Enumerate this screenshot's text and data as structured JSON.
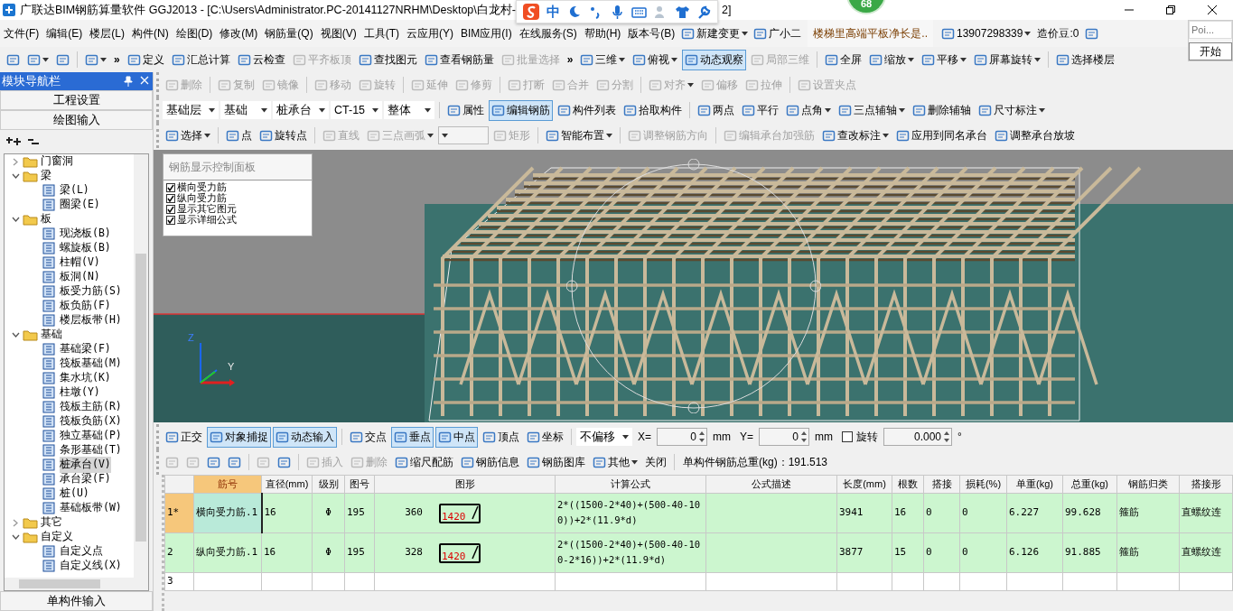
{
  "window": {
    "title": "广联达BIM钢筋算量软件 GGJ2013 - [C:\\Users\\Administrator.PC-20141127NRHM\\Desktop\\白龙村-",
    "title_tail": "2]",
    "badge": "68"
  },
  "ime_bar": {
    "mode": "中"
  },
  "menu_bar": {
    "menus": [
      "文件(F)",
      "编辑(E)",
      "楼层(L)",
      "构件(N)",
      "绘图(D)",
      "修改(M)",
      "钢筋量(Q)",
      "视图(V)",
      "工具(T)",
      "云应用(Y)",
      "BIM应用(I)",
      "在线服务(S)",
      "帮助(H)",
      "版本号(B)"
    ],
    "extras": [
      {
        "kind": "tool",
        "label": "新建变更",
        "disabled": false,
        "pressed": false,
        "dropdown": true
      },
      {
        "kind": "tool",
        "label": "广小二",
        "disabled": false,
        "pressed": false,
        "dropdown": false
      },
      {
        "kind": "news",
        "label": "楼梯里高端平板净长是.."
      },
      {
        "kind": "tool",
        "label": "13907298339",
        "disabled": false,
        "pressed": false,
        "dropdown": true
      },
      {
        "kind": "label",
        "label": "造价豆:0"
      },
      {
        "kind": "icon_tool",
        "disabled": false,
        "pressed": false,
        "dropdown": false
      }
    ]
  },
  "popup": {
    "placeholder": "Poi...",
    "button": "开始"
  },
  "main_toolbar": [
    {
      "kind": "icon_tool",
      "disabled": false,
      "pressed": false,
      "dropdown": false
    },
    {
      "kind": "icon_tool",
      "disabled": false,
      "pressed": false,
      "dropdown": true
    },
    {
      "kind": "icon_tool",
      "disabled": false,
      "pressed": false,
      "dropdown": false
    },
    {
      "kind": "sep"
    },
    {
      "kind": "icon_tool",
      "disabled": false,
      "pressed": false,
      "dropdown": true
    },
    {
      "kind": "overflow",
      "label": "»"
    },
    {
      "kind": "tool",
      "label": "定义",
      "disabled": false,
      "pressed": false,
      "dropdown": false
    },
    {
      "kind": "tool",
      "label": "汇总计算",
      "disabled": false,
      "pressed": false,
      "dropdown": false
    },
    {
      "kind": "tool",
      "label": "云检查",
      "disabled": false,
      "pressed": false,
      "dropdown": false
    },
    {
      "kind": "tool",
      "label": "平齐板顶",
      "disabled": true,
      "pressed": false,
      "dropdown": false
    },
    {
      "kind": "tool",
      "label": "查找图元",
      "disabled": false,
      "pressed": false,
      "dropdown": false
    },
    {
      "kind": "tool",
      "label": "查看钢筋量",
      "disabled": false,
      "pressed": false,
      "dropdown": false
    },
    {
      "kind": "tool",
      "label": "批量选择",
      "disabled": true,
      "pressed": false,
      "dropdown": false
    },
    {
      "kind": "overflow",
      "label": "»"
    },
    {
      "kind": "tool",
      "label": "三维",
      "disabled": false,
      "pressed": false,
      "dropdown": true
    },
    {
      "kind": "tool",
      "label": "俯视",
      "disabled": false,
      "pressed": false,
      "dropdown": true
    },
    {
      "kind": "tool",
      "label": "动态观察",
      "disabled": false,
      "pressed": true,
      "dropdown": false
    },
    {
      "kind": "tool",
      "label": "局部三维",
      "disabled": true,
      "pressed": false,
      "dropdown": false
    },
    {
      "kind": "sep"
    },
    {
      "kind": "tool",
      "label": "全屏",
      "disabled": false,
      "pressed": false,
      "dropdown": false
    },
    {
      "kind": "tool",
      "label": "缩放",
      "disabled": false,
      "pressed": false,
      "dropdown": true
    },
    {
      "kind": "tool",
      "label": "平移",
      "disabled": false,
      "pressed": false,
      "dropdown": true
    },
    {
      "kind": "tool",
      "label": "屏幕旋转",
      "disabled": false,
      "pressed": false,
      "dropdown": true
    },
    {
      "kind": "sep"
    },
    {
      "kind": "tool",
      "label": "选择楼层",
      "disabled": false,
      "pressed": false,
      "dropdown": false
    }
  ],
  "sidebar": {
    "title": "模块导航栏",
    "buttons": [
      "工程设置",
      "绘图输入"
    ],
    "bottom_button": "单构件输入",
    "tree": [
      {
        "label": "门窗洞",
        "expanded": false,
        "selected": false
      },
      {
        "label": "梁",
        "expanded": true,
        "selected": false,
        "children": [
          {
            "label": "梁(L)",
            "selected": false
          },
          {
            "label": "圈梁(E)",
            "selected": false
          }
        ]
      },
      {
        "label": "板",
        "expanded": true,
        "selected": false,
        "children": [
          {
            "label": "现浇板(B)",
            "selected": false
          },
          {
            "label": "螺旋板(B)",
            "selected": false
          },
          {
            "label": "柱帽(V)",
            "selected": false
          },
          {
            "label": "板洞(N)",
            "selected": false
          },
          {
            "label": "板受力筋(S)",
            "selected": false
          },
          {
            "label": "板负筋(F)",
            "selected": false
          },
          {
            "label": "楼层板带(H)",
            "selected": false
          }
        ]
      },
      {
        "label": "基础",
        "expanded": true,
        "selected": false,
        "children": [
          {
            "label": "基础梁(F)",
            "selected": false
          },
          {
            "label": "筏板基础(M)",
            "selected": false
          },
          {
            "label": "集水坑(K)",
            "selected": false
          },
          {
            "label": "柱墩(Y)",
            "selected": false
          },
          {
            "label": "筏板主筋(R)",
            "selected": false
          },
          {
            "label": "筏板负筋(X)",
            "selected": false
          },
          {
            "label": "独立基础(P)",
            "selected": false
          },
          {
            "label": "条形基础(T)",
            "selected": false
          },
          {
            "label": "桩承台(V)",
            "selected": true
          },
          {
            "label": "承台梁(F)",
            "selected": false
          },
          {
            "label": "桩(U)",
            "selected": false
          },
          {
            "label": "基础板带(W)",
            "selected": false
          }
        ]
      },
      {
        "label": "其它",
        "expanded": false,
        "selected": false
      },
      {
        "label": "自定义",
        "expanded": true,
        "selected": false,
        "children": [
          {
            "label": "自定义点",
            "selected": false
          },
          {
            "label": "自定义线(X)",
            "selected": false
          }
        ]
      }
    ]
  },
  "edit_toolbar": [
    {
      "kind": "tool",
      "label": "删除",
      "disabled": true,
      "pressed": false,
      "dropdown": false
    },
    {
      "kind": "sep"
    },
    {
      "kind": "tool",
      "label": "复制",
      "disabled": true,
      "pressed": false,
      "dropdown": false
    },
    {
      "kind": "tool",
      "label": "镜像",
      "disabled": true,
      "pressed": false,
      "dropdown": false
    },
    {
      "kind": "sep"
    },
    {
      "kind": "tool",
      "label": "移动",
      "disabled": true,
      "pressed": false,
      "dropdown": false
    },
    {
      "kind": "tool",
      "label": "旋转",
      "disabled": true,
      "pressed": false,
      "dropdown": false
    },
    {
      "kind": "sep"
    },
    {
      "kind": "tool",
      "label": "延伸",
      "disabled": true,
      "pressed": false,
      "dropdown": false
    },
    {
      "kind": "tool",
      "label": "修剪",
      "disabled": true,
      "pressed": false,
      "dropdown": false
    },
    {
      "kind": "sep"
    },
    {
      "kind": "tool",
      "label": "打断",
      "disabled": true,
      "pressed": false,
      "dropdown": false
    },
    {
      "kind": "tool",
      "label": "合并",
      "disabled": true,
      "pressed": false,
      "dropdown": false
    },
    {
      "kind": "tool",
      "label": "分割",
      "disabled": true,
      "pressed": false,
      "dropdown": false
    },
    {
      "kind": "sep"
    },
    {
      "kind": "tool",
      "label": "对齐",
      "disabled": true,
      "pressed": false,
      "dropdown": true
    },
    {
      "kind": "tool",
      "label": "偏移",
      "disabled": true,
      "pressed": false,
      "dropdown": false
    },
    {
      "kind": "tool",
      "label": "拉伸",
      "disabled": true,
      "pressed": false,
      "dropdown": false
    },
    {
      "kind": "sep"
    },
    {
      "kind": "tool",
      "label": "设置夹点",
      "disabled": true,
      "pressed": false,
      "dropdown": false
    }
  ],
  "layer_toolbar": [
    {
      "kind": "select",
      "label": "基础层",
      "disabled": false
    },
    {
      "kind": "select",
      "label": "基础",
      "disabled": false
    },
    {
      "kind": "select",
      "label": "桩承台",
      "disabled": false
    },
    {
      "kind": "select",
      "label": "CT-15",
      "disabled": false
    },
    {
      "kind": "select",
      "label": "整体",
      "disabled": false
    },
    {
      "kind": "sep"
    },
    {
      "kind": "tool",
      "label": "属性",
      "disabled": false,
      "pressed": false,
      "dropdown": false
    },
    {
      "kind": "tool",
      "label": "编辑钢筋",
      "disabled": false,
      "pressed": true,
      "dropdown": false
    },
    {
      "kind": "tool",
      "label": "构件列表",
      "disabled": false,
      "pressed": false,
      "dropdown": false
    },
    {
      "kind": "tool",
      "label": "拾取构件",
      "disabled": false,
      "pressed": false,
      "dropdown": false
    },
    {
      "kind": "sep"
    },
    {
      "kind": "tool",
      "label": "两点",
      "disabled": false,
      "pressed": false,
      "dropdown": false
    },
    {
      "kind": "tool",
      "label": "平行",
      "disabled": false,
      "pressed": false,
      "dropdown": false
    },
    {
      "kind": "tool",
      "label": "点角",
      "disabled": false,
      "pressed": false,
      "dropdown": true
    },
    {
      "kind": "tool",
      "label": "三点辅轴",
      "disabled": false,
      "pressed": false,
      "dropdown": true
    },
    {
      "kind": "tool",
      "label": "删除辅轴",
      "disabled": false,
      "pressed": false,
      "dropdown": false
    },
    {
      "kind": "tool",
      "label": "尺寸标注",
      "disabled": false,
      "pressed": false,
      "dropdown": true
    }
  ],
  "draw_toolbar": [
    {
      "kind": "tool",
      "label": "选择",
      "disabled": false,
      "pressed": false,
      "dropdown": true
    },
    {
      "kind": "sep"
    },
    {
      "kind": "tool",
      "label": "点",
      "disabled": false,
      "pressed": false,
      "dropdown": false
    },
    {
      "kind": "tool",
      "label": "旋转点",
      "disabled": false,
      "pressed": false,
      "dropdown": false
    },
    {
      "kind": "sep"
    },
    {
      "kind": "tool",
      "label": "直线",
      "disabled": true,
      "pressed": false,
      "dropdown": false
    },
    {
      "kind": "tool",
      "label": "三点画弧",
      "disabled": true,
      "pressed": false,
      "dropdown": true
    },
    {
      "kind": "select",
      "disabled": true
    },
    {
      "kind": "tool",
      "label": "矩形",
      "disabled": true,
      "pressed": false,
      "dropdown": false
    },
    {
      "kind": "sep"
    },
    {
      "kind": "tool",
      "label": "智能布置",
      "disabled": false,
      "pressed": false,
      "dropdown": true
    },
    {
      "kind": "sep"
    },
    {
      "kind": "tool",
      "label": "调整钢筋方向",
      "disabled": true,
      "pressed": false,
      "dropdown": false
    },
    {
      "kind": "sep"
    },
    {
      "kind": "tool",
      "label": "编辑承台加强筋",
      "disabled": true,
      "pressed": false,
      "dropdown": false
    },
    {
      "kind": "tool",
      "label": "查改标注",
      "disabled": false,
      "pressed": false,
      "dropdown": true
    },
    {
      "kind": "tool",
      "label": "应用到同名承台",
      "disabled": false,
      "pressed": false,
      "dropdown": false
    },
    {
      "kind": "tool",
      "label": "调整承台放坡",
      "disabled": false,
      "pressed": false,
      "dropdown": false
    }
  ],
  "viewport": {
    "panel": {
      "title": "钢筋显示控制面板",
      "options": [
        {
          "label": "横向受力筋",
          "checked": true
        },
        {
          "label": "纵向受力筋",
          "checked": true
        },
        {
          "label": "显示其它图元",
          "checked": true
        },
        {
          "label": "显示详细公式",
          "checked": true
        }
      ]
    },
    "axes": [
      "Z",
      "Y"
    ]
  },
  "snap_toolbar": [
    {
      "kind": "tool",
      "label": "正交",
      "disabled": false,
      "pressed": false,
      "dropdown": false
    },
    {
      "kind": "tool",
      "label": "对象捕捉",
      "disabled": false,
      "pressed": true,
      "dropdown": false
    },
    {
      "kind": "tool",
      "label": "动态输入",
      "disabled": false,
      "pressed": true,
      "dropdown": false
    },
    {
      "kind": "sep"
    },
    {
      "kind": "tool",
      "label": "交点",
      "disabled": false,
      "pressed": false,
      "dropdown": false
    },
    {
      "kind": "tool",
      "label": "垂点",
      "disabled": false,
      "pressed": true,
      "dropdown": false
    },
    {
      "kind": "tool",
      "label": "中点",
      "disabled": false,
      "pressed": true,
      "dropdown": false
    },
    {
      "kind": "tool",
      "label": "顶点",
      "disabled": false,
      "pressed": false,
      "dropdown": false
    },
    {
      "kind": "tool",
      "label": "坐标",
      "disabled": false,
      "pressed": false,
      "dropdown": false
    },
    {
      "kind": "sep"
    },
    {
      "kind": "select",
      "label": "不偏移",
      "disabled": false
    },
    {
      "kind": "label",
      "label": "X="
    },
    {
      "kind": "spin",
      "value": "0"
    },
    {
      "kind": "label",
      "label": "mm"
    },
    {
      "kind": "label",
      "label": "Y="
    },
    {
      "kind": "spin",
      "value": "0"
    },
    {
      "kind": "label",
      "label": "mm"
    },
    {
      "kind": "check",
      "label": "旋转",
      "checked": false
    },
    {
      "kind": "spin",
      "value": "0.000"
    },
    {
      "kind": "label",
      "label": "°"
    }
  ],
  "rebar_toolbar": [
    {
      "kind": "icon_tool",
      "disabled": true,
      "pressed": false,
      "dropdown": false
    },
    {
      "kind": "icon_tool",
      "disabled": true,
      "pressed": false,
      "dropdown": false
    },
    {
      "kind": "icon_tool",
      "disabled": false,
      "pressed": false,
      "dropdown": false
    },
    {
      "kind": "icon_tool",
      "disabled": false,
      "pressed": false,
      "dropdown": false
    },
    {
      "kind": "sep"
    },
    {
      "kind": "icon_tool",
      "disabled": true,
      "pressed": false,
      "dropdown": false
    },
    {
      "kind": "icon_tool",
      "disabled": false,
      "pressed": false,
      "dropdown": false
    },
    {
      "kind": "sep"
    },
    {
      "kind": "tool",
      "label": "插入",
      "disabled": true,
      "pressed": false,
      "dropdown": false
    },
    {
      "kind": "tool",
      "label": "删除",
      "disabled": true,
      "pressed": false,
      "dropdown": false
    },
    {
      "kind": "tool",
      "label": "缩尺配筋",
      "disabled": false,
      "pressed": false,
      "dropdown": false
    },
    {
      "kind": "tool",
      "label": "钢筋信息",
      "disabled": false,
      "pressed": false,
      "dropdown": false
    },
    {
      "kind": "tool",
      "label": "钢筋图库",
      "disabled": false,
      "pressed": false,
      "dropdown": false
    },
    {
      "kind": "tool",
      "label": "其他",
      "disabled": false,
      "pressed": false,
      "dropdown": true
    },
    {
      "kind": "text_tool",
      "label": "关闭"
    },
    {
      "kind": "sep"
    },
    {
      "kind": "label",
      "label": "单构件钢筋总重(kg)：191.513"
    }
  ],
  "table": {
    "columns": [
      "筋号",
      "直径(mm)",
      "级别",
      "图号",
      "图形",
      "计算公式",
      "公式描述",
      "长度(mm)",
      "根数",
      "搭接",
      "损耗(%)",
      "单重(kg)",
      "总重(kg)",
      "钢筋归类",
      "搭接形"
    ],
    "rows": [
      {
        "header": "1*",
        "selected": true,
        "bar_name": "横向受力筋.1",
        "diameter": "16",
        "grade": "Φ",
        "figure_no": "195",
        "figure": {
          "length": "360",
          "bend": "1420"
        },
        "formula": "2*((1500-2*40)+(500-40-100))+2*(11.9*d)",
        "length": "3941",
        "count": "16",
        "lap": "0",
        "loss": "0",
        "unit_weight": "6.227",
        "total_weight": "99.628",
        "category": "箍筋",
        "lap_type": "直螺纹连"
      },
      {
        "header": "2",
        "selected": false,
        "bar_name": "纵向受力筋.1",
        "diameter": "16",
        "grade": "Φ",
        "figure_no": "195",
        "figure": {
          "length": "328",
          "bend": "1420"
        },
        "formula": "2*((1500-2*40)+(500-40-100-2*16))+2*(11.9*d)",
        "length": "3877",
        "count": "15",
        "lap": "0",
        "loss": "0",
        "unit_weight": "6.126",
        "total_weight": "91.885",
        "category": "箍筋",
        "lap_type": "直螺纹连"
      },
      {
        "header": "3",
        "selected": false
      }
    ]
  }
}
